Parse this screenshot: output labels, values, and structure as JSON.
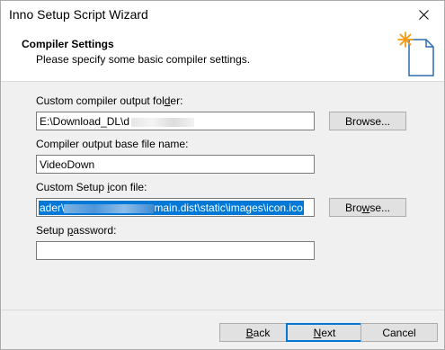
{
  "window": {
    "title": "Inno Setup Script Wizard",
    "close_icon": "close-icon"
  },
  "header": {
    "title": "Compiler Settings",
    "subtitle": "Please specify some basic compiler settings.",
    "icon": "wizard-document-icon",
    "accent_color": "#f39c12"
  },
  "fields": {
    "output_folder": {
      "label_pre": "Custom compiler output fol",
      "label_accel": "d",
      "label_post": "er:",
      "value_visible": "E:\\Download_DL\\d"
    },
    "base_name": {
      "label": "Compiler output base file name:",
      "value": "VideoDown"
    },
    "icon_file": {
      "label_pre": "Custom Setup ",
      "label_accel": "i",
      "label_post": "con file:",
      "value_start": "ader\\",
      "value_end": "main.dist\\static\\images\\icon.ico"
    },
    "password": {
      "label_pre": "Setup ",
      "label_accel": "p",
      "label_post": "assword:",
      "value": ""
    }
  },
  "buttons": {
    "browse1": "Browse...",
    "browse2_pre": "Bro",
    "browse2_accel": "w",
    "browse2_post": "se...",
    "back_accel": "B",
    "back_post": "ack",
    "next_accel": "N",
    "next_post": "ext",
    "cancel": "Cancel"
  },
  "colors": {
    "selection": "#0078d7",
    "dialog_bg": "#f0f0f0"
  }
}
